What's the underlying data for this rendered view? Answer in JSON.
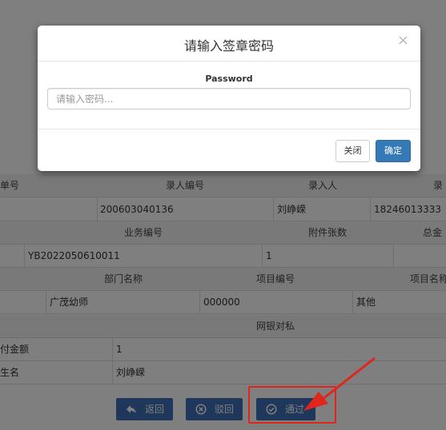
{
  "modal": {
    "title": "请输入签章密码",
    "close_glyph": "×",
    "password_label": "Password",
    "password_placeholder": "请输入密码...",
    "password_value": "",
    "close_button": "关闭",
    "confirm_button": "确定"
  },
  "table": {
    "row1": {
      "c1": "单号",
      "c2": "录人编号",
      "c3": "录入人",
      "c4": "录"
    },
    "row2": {
      "entry_no": "200603040136",
      "entry_person": "刘峥嵘",
      "phone": "18246013333"
    },
    "row3": {
      "business_no": "业务编号",
      "attachments": "附件张数",
      "total": "总金"
    },
    "row4": {
      "business_no": "YB2022050610011",
      "attachments": "1"
    },
    "row5": {
      "dept": "部门名称",
      "project_no": "项目编号",
      "project_name": "项目名称"
    },
    "row6": {
      "dept": "广茂幼师",
      "project_no": "000000",
      "project_name": "其他"
    },
    "row7": {
      "bank": "网银对私"
    },
    "row8": {
      "label": "付金额",
      "value": "1"
    },
    "row9": {
      "label": "生名",
      "value": "刘峥嵘"
    }
  },
  "actions": {
    "back": "返回",
    "reject": "驳回",
    "approve": "通过"
  },
  "colors": {
    "primary_button": "#3c6fb6",
    "annotation": "#e0261c",
    "modal_confirm": "#337ab7"
  }
}
